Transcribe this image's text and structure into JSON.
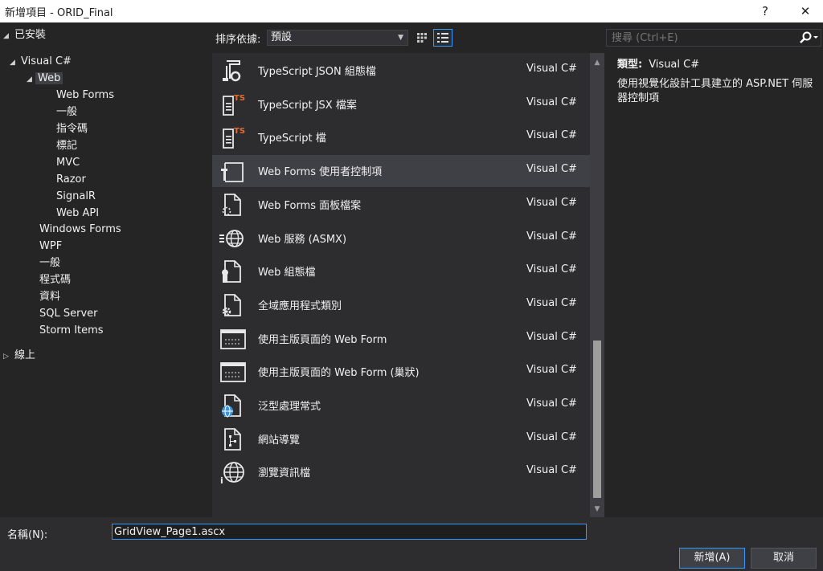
{
  "window": {
    "title": "新增項目 - ORID_Final",
    "help_label": "?",
    "close_label": "✕"
  },
  "tree": {
    "installed": "已安裝",
    "visual_csharp": "Visual C#",
    "web": "Web",
    "web_children": [
      "Web Forms",
      "一般",
      "指令碼",
      "標記",
      "MVC",
      "Razor",
      "SignalR",
      "Web API"
    ],
    "csharp_children": [
      "Windows Forms",
      "WPF",
      "一般",
      "程式碼",
      "資料",
      "SQL Server",
      "Storm Items"
    ],
    "online": "線上"
  },
  "toolbar": {
    "sort_label": "排序依據:",
    "sort_value": "預設",
    "search_placeholder": "搜尋 (Ctrl+E)"
  },
  "templates": [
    {
      "name": "TypeScript JSON 組態檔",
      "lang": "Visual C#",
      "icon": "typescript-json-config-icon"
    },
    {
      "name": "TypeScript JSX 檔案",
      "lang": "Visual C#",
      "icon": "typescript-jsx-file-icon"
    },
    {
      "name": "TypeScript 檔",
      "lang": "Visual C#",
      "icon": "typescript-file-icon"
    },
    {
      "name": "Web Forms 使用者控制項",
      "lang": "Visual C#",
      "icon": "user-control-icon"
    },
    {
      "name": "Web Forms 面板檔案",
      "lang": "Visual C#",
      "icon": "skin-file-icon"
    },
    {
      "name": "Web 服務 (ASMX)",
      "lang": "Visual C#",
      "icon": "web-service-icon"
    },
    {
      "name": "Web 組態檔",
      "lang": "Visual C#",
      "icon": "web-config-icon"
    },
    {
      "name": "全域應用程式類別",
      "lang": "Visual C#",
      "icon": "global-app-class-icon"
    },
    {
      "name": "使用主版頁面的 Web Form",
      "lang": "Visual C#",
      "icon": "web-form-master-icon"
    },
    {
      "name": "使用主版頁面的 Web Form (巢狀)",
      "lang": "Visual C#",
      "icon": "web-form-nested-master-icon"
    },
    {
      "name": "泛型處理常式",
      "lang": "Visual C#",
      "icon": "generic-handler-icon"
    },
    {
      "name": "網站導覽",
      "lang": "Visual C#",
      "icon": "sitemap-icon"
    },
    {
      "name": "瀏覽資訊檔",
      "lang": "Visual C#",
      "icon": "browser-file-icon"
    }
  ],
  "selected_index": 3,
  "info": {
    "type_label": "類型:",
    "type_value": "Visual C#",
    "description": "使用視覺化設計工具建立的 ASP.NET 伺服器控制項"
  },
  "bottom": {
    "name_label": "名稱(N):",
    "name_value": "GridView_Page1.ascx",
    "add_label": "新增(A)",
    "cancel_label": "取消"
  },
  "colors": {
    "background": "#252526",
    "panel": "#2d2d30",
    "selection": "#3f3f46",
    "accent": "#3399ff",
    "typescript_badge": "#e86a2b",
    "globe": "#3a96dd"
  }
}
